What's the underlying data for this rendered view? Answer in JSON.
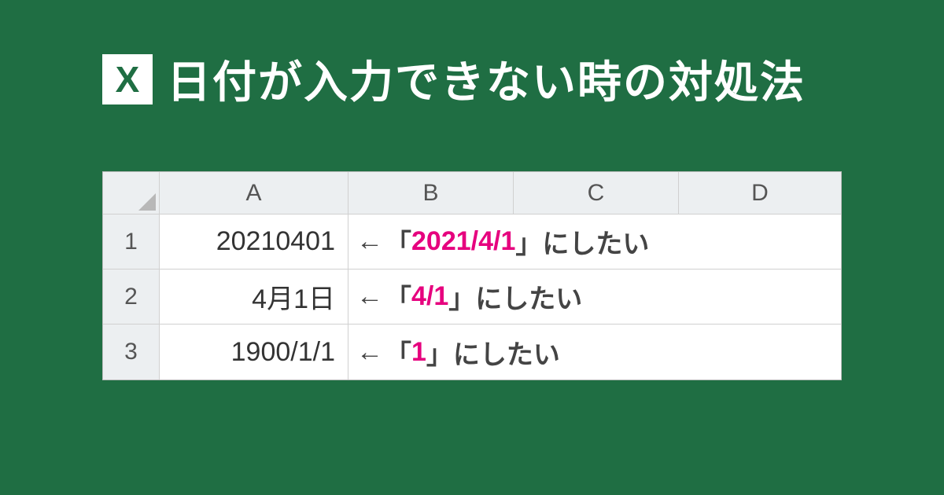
{
  "header": {
    "icon_letter": "X",
    "title": "日付が入力できない時の対処法"
  },
  "sheet": {
    "columns": [
      "A",
      "B",
      "C",
      "D"
    ],
    "rows": [
      {
        "num": "1",
        "a": "20210401",
        "arrow": "←",
        "pre": "「",
        "hl": "2021/4/1",
        "post": "」にしたい"
      },
      {
        "num": "2",
        "a": "4月1日",
        "arrow": "←",
        "pre": "「",
        "hl": "4/1",
        "post": "」にしたい"
      },
      {
        "num": "3",
        "a": "1900/1/1",
        "arrow": "←",
        "pre": "「",
        "hl": "1",
        "post": "」にしたい"
      }
    ]
  }
}
